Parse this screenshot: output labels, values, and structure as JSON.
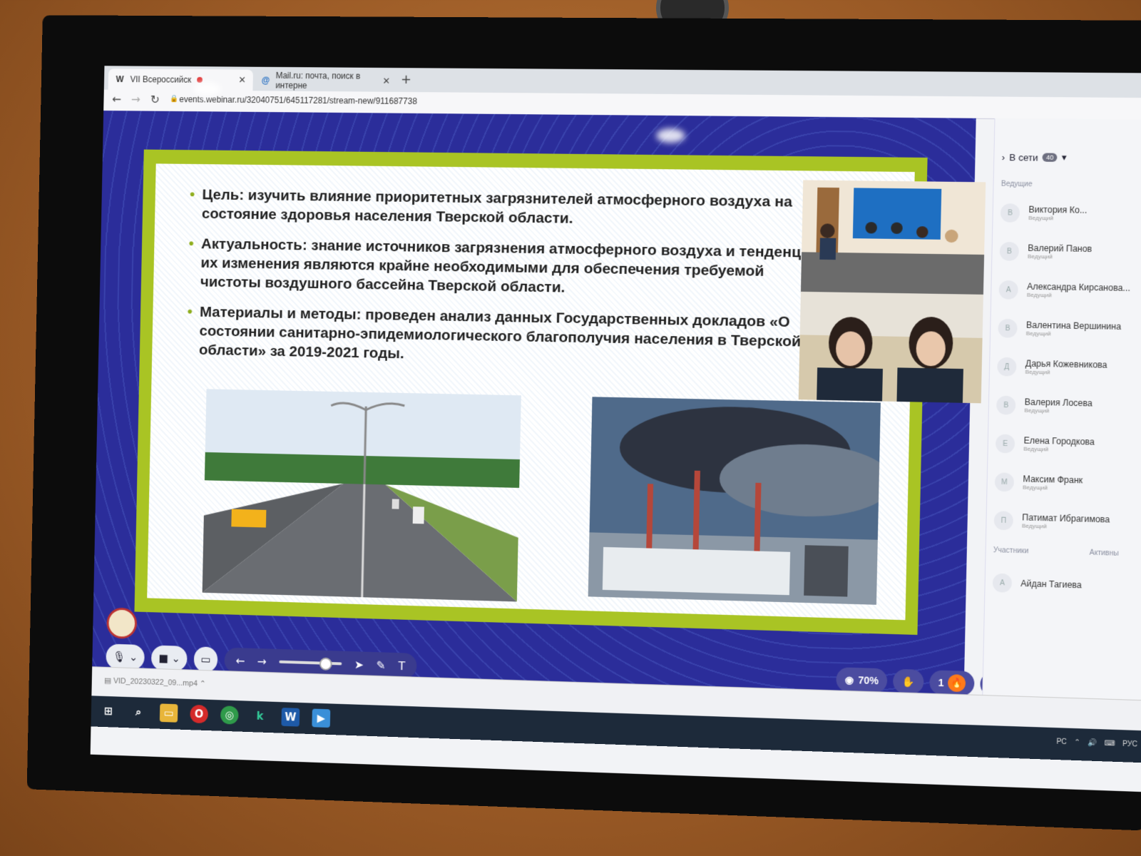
{
  "browser": {
    "tabs": [
      {
        "icon": "W",
        "title": "VII Всероссийск"
      },
      {
        "icon": "@",
        "title": "Mail.ru: почта, поиск в интерне"
      }
    ],
    "url": "events.webinar.ru/32040751/645117281/stream-new/911687738"
  },
  "slide": {
    "bullets": [
      "Цель: изучить влияние приоритетных загрязнителей атмосферного воздуха на состояние здоровья населения Тверской области.",
      "Актуальность: знание источников загрязнения атмосферного воздуха и тенденции их изменения являются крайне необходимыми для обеспечения требуемой чистоты воздушного бассейна Тверской области.",
      "Материалы и методы: проведен анализ данных Государственных докладов «О состоянии санитарно-эпидемиологического благополучия населения в Тверской области» за 2019-2021 годы."
    ]
  },
  "controls": {
    "viewers_percent": "70%",
    "hands": "1"
  },
  "panel": {
    "online_label": "В сети",
    "online_count": "40",
    "hosts_label": "Ведущие",
    "participants_label": "Участники",
    "active_label": "Активны",
    "hosts": [
      {
        "initial": "В",
        "name": "Виктория Ко...",
        "role": "Ведущий"
      },
      {
        "initial": "В",
        "name": "Валерий Панов",
        "role": "Ведущий"
      },
      {
        "initial": "А",
        "name": "Александра Кирсанова...",
        "role": "Ведущий"
      },
      {
        "initial": "В",
        "name": "Валентина Вершинина",
        "role": "Ведущий"
      },
      {
        "initial": "Д",
        "name": "Дарья Кожевникова",
        "role": "Ведущий"
      },
      {
        "initial": "В",
        "name": "Валерия Лосева",
        "role": "Ведущий"
      },
      {
        "initial": "Е",
        "name": "Елена Городкова",
        "role": "Ведущий"
      },
      {
        "initial": "М",
        "name": "Максим Франк",
        "role": "Ведущий"
      },
      {
        "initial": "П",
        "name": "Патимат Ибрагимова",
        "role": "Ведущий"
      }
    ],
    "participants": [
      {
        "initial": "А",
        "name": "Айдан Тагиева"
      }
    ]
  },
  "download": {
    "file": "VID_20230322_09...mp4"
  },
  "taskbar": {
    "lang": "РУС",
    "layout": "РС"
  }
}
